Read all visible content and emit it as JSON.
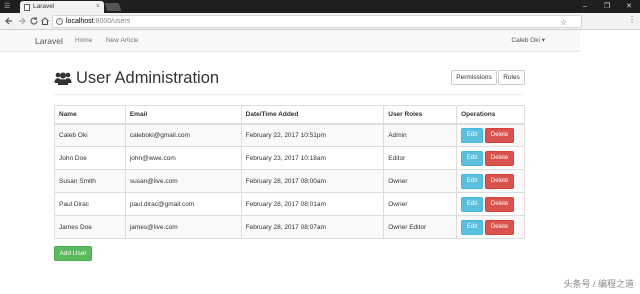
{
  "browser": {
    "tab_title": "Laravel",
    "tab_close": "×",
    "window_controls": [
      "–",
      "❐",
      "✕"
    ],
    "url_host": "localhost",
    "url_rest": ":8000/users",
    "nav_icons": [
      "back-icon",
      "forward-icon",
      "reload-icon"
    ]
  },
  "navbar": {
    "brand": "Laravel",
    "links": [
      "Home",
      "New Article"
    ],
    "user": "Caleb Oki ▾"
  },
  "header": {
    "title": "User Administration",
    "buttons": [
      "Permissions",
      "Roles"
    ]
  },
  "table": {
    "columns": [
      "Name",
      "Email",
      "Date/Time Added",
      "User Roles",
      "Operations"
    ],
    "rows": [
      {
        "name": "Caleb Oki",
        "email": "caleboki@gmail.com",
        "added": "February 22, 2017 10:51pm",
        "roles": "Admin"
      },
      {
        "name": "John Doe",
        "email": "john@wwe.com",
        "added": "February 23, 2017 10:18am",
        "roles": "Editor"
      },
      {
        "name": "Susan Smith",
        "email": "susan@live.com",
        "added": "February 28, 2017 08:00am",
        "roles": "Owner"
      },
      {
        "name": "Paul Dirac",
        "email": "paul.dirac@gmail.com",
        "added": "February 28, 2017 08:01am",
        "roles": "Owner"
      },
      {
        "name": "James Doe",
        "email": "james@live.com",
        "added": "February 28, 2017 08:07am",
        "roles": "Owner Editor"
      }
    ],
    "edit_label": "Edit",
    "delete_label": "Delete"
  },
  "add_user_label": "Add User",
  "watermark": "头条号 / 编程之道",
  "colors": {
    "edit": "#5bc0de",
    "delete": "#d9534f",
    "add": "#5cb85c"
  }
}
